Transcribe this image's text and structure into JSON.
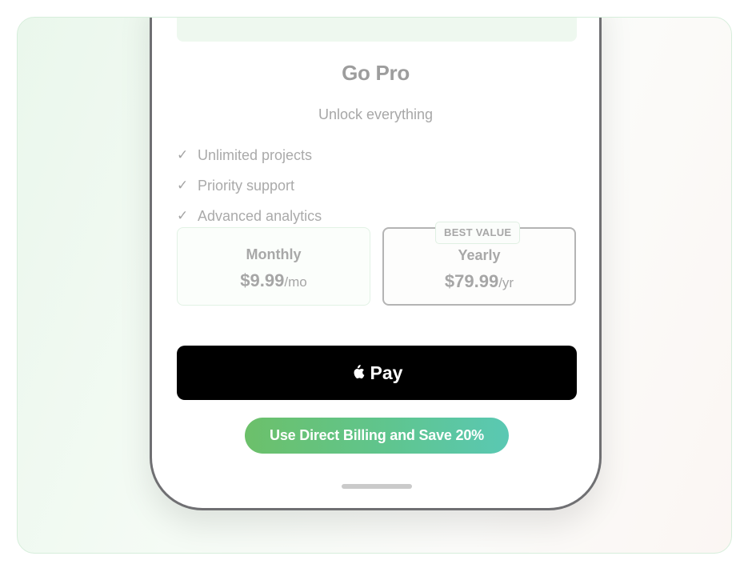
{
  "paywall": {
    "title": "Go Pro",
    "subtitle": "Unlock everything",
    "features": [
      {
        "check": "✓",
        "label": "Unlimited projects"
      },
      {
        "check": "✓",
        "label": "Priority support"
      },
      {
        "check": "✓",
        "label": "Advanced analytics"
      }
    ],
    "plans": {
      "monthly": {
        "name": "Monthly",
        "price": "$9.99",
        "period": "/mo"
      },
      "yearly": {
        "name": "Yearly",
        "price": "$79.99",
        "period": "/yr",
        "badge": "BEST VALUE",
        "selected": true
      }
    },
    "apple_pay": {
      "icon": "apple-logo-icon",
      "label": "Pay"
    },
    "direct_billing": {
      "label": "Use Direct Billing and Save 20%"
    }
  },
  "colors": {
    "apple_pay_background": "#000000",
    "direct_billing_gradient_start": "#6cc06a",
    "direct_billing_gradient_end": "#5ac8b3",
    "card_border": "#d6eedb"
  }
}
